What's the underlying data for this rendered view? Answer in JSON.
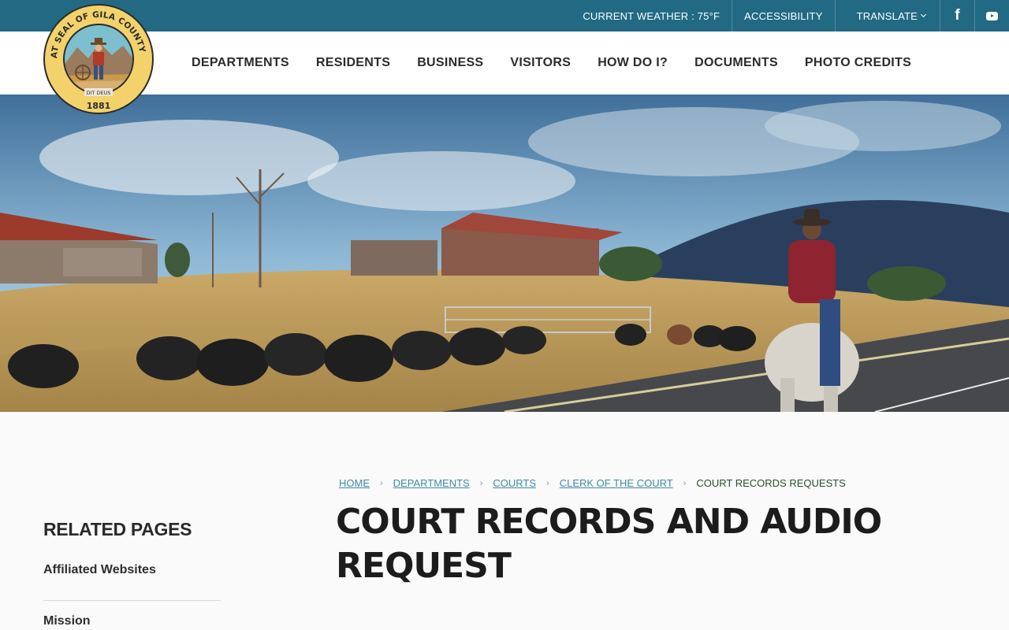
{
  "topbar": {
    "weather": "CURRENT WEATHER : 75°F",
    "accessibility": "ACCESSIBILITY",
    "translate": "TRANSLATE",
    "facebook": "f"
  },
  "seal": {
    "ring_text": "THE GREAT SEAL OF GILA COUNTY ARIZONA",
    "motto": "DIT DEUS",
    "year": "1881"
  },
  "nav": {
    "items": [
      "DEPARTMENTS",
      "RESIDENTS",
      "BUSINESS",
      "VISITORS",
      "HOW DO I?",
      "DOCUMENTS",
      "PHOTO CREDITS"
    ]
  },
  "breadcrumb": {
    "items": [
      "HOME",
      "DEPARTMENTS",
      "COURTS",
      "CLERK OF THE COURT"
    ],
    "separator": "›",
    "current": "COURT RECORDS REQUESTS"
  },
  "page": {
    "title_line1": "COURT RECORDS AND AUDIO",
    "title_line2": "REQUEST"
  },
  "related": {
    "title": "RELATED PAGES",
    "items": [
      "Affiliated Websites",
      "Mission"
    ]
  },
  "colors": {
    "topbar": "#226a83",
    "link": "#3c8ba7",
    "breadcrumb_current": "#2a4f2a",
    "heading": "#1c1c1c"
  },
  "icons": [
    "chevron-down-icon",
    "facebook-icon",
    "youtube-icon"
  ]
}
